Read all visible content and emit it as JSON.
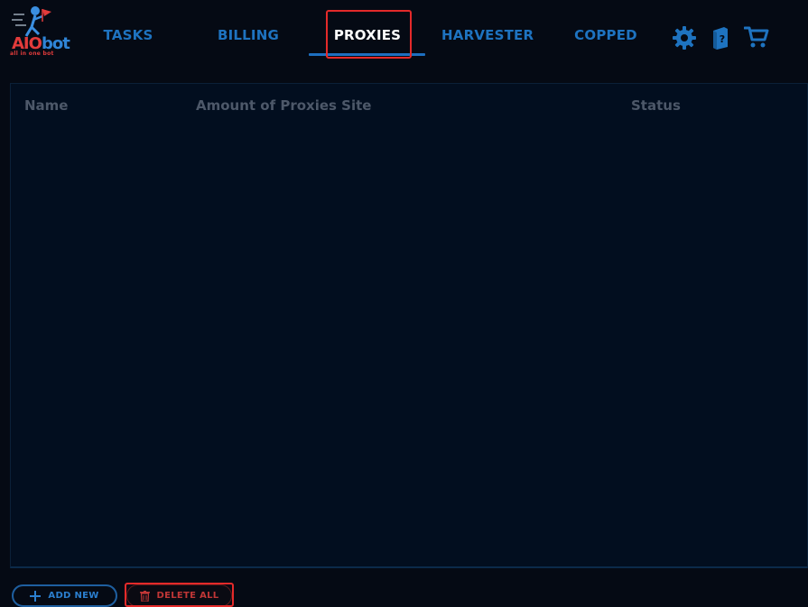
{
  "app": {
    "logo_text_a": "AIO",
    "logo_text_b": "bot",
    "logo_tagline": "all in one bot"
  },
  "nav": {
    "tasks": "TASKS",
    "billing": "BILLING",
    "proxies": "PROXIES",
    "harvester": "HARVESTER",
    "copped": "COPPED",
    "active": "proxies"
  },
  "icons": {
    "settings": "gear-icon",
    "help": "book-help-icon",
    "cart": "cart-icon"
  },
  "table": {
    "columns": [
      "Name",
      "Amount of Proxies Site",
      "Status"
    ],
    "rows": []
  },
  "actions": {
    "add_new": "ADD NEW",
    "delete_all": "DELETE ALL"
  },
  "colors": {
    "accent": "#1e73c0",
    "background": "#050a14",
    "panel": "#020e1f",
    "danger": "#c03636",
    "highlight": "#e42a2a"
  }
}
